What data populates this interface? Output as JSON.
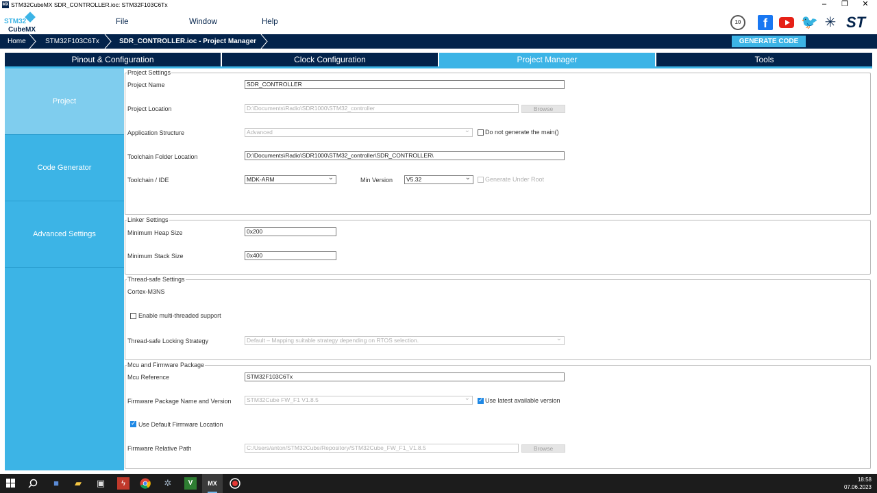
{
  "window": {
    "title": "STM32CubeMX SDR_CONTROLLER.ioc: STM32F103C6Tx",
    "app_icon": "MX",
    "minimize": "–",
    "restore": "❐",
    "close": "✕"
  },
  "logo": {
    "line1": "STM32",
    "line2": "CubeMX"
  },
  "menu": {
    "file": "File",
    "window": "Window",
    "help": "Help"
  },
  "social": {
    "anniversary": "10",
    "facebook": "f",
    "twitter": "🐦",
    "network": "✳",
    "st": "ST"
  },
  "breadcrumb": {
    "home": "Home",
    "mcu": "STM32F103C6Tx",
    "current": "SDR_CONTROLLER.ioc - Project Manager"
  },
  "generate_button": "GENERATE CODE",
  "tabs": {
    "pinout": "Pinout & Configuration",
    "clock": "Clock Configuration",
    "project_manager": "Project Manager",
    "tools": "Tools"
  },
  "sidebar": {
    "project": "Project",
    "code_generator": "Code Generator",
    "advanced": "Advanced Settings"
  },
  "project_settings": {
    "legend": "Project Settings",
    "name_label": "Project Name",
    "name_value": "SDR_CONTROLLER",
    "location_label": "Project Location",
    "location_value": "D:\\Documents\\Radio\\SDR1000\\STM32_controller",
    "browse": "Browse",
    "app_structure_label": "Application Structure",
    "app_structure_value": "Advanced",
    "no_main_label": "Do not generate the main()",
    "toolchain_folder_label": "Toolchain Folder Location",
    "toolchain_folder_value": "D:\\Documents\\Radio\\SDR1000\\STM32_controller\\SDR_CONTROLLER\\",
    "toolchain_label": "Toolchain / IDE",
    "toolchain_value": "MDK-ARM",
    "min_version_label": "Min Version",
    "min_version_value": "V5.32",
    "gen_under_root_label": "Generate Under Root"
  },
  "linker_settings": {
    "legend": "Linker Settings",
    "heap_label": "Minimum Heap Size",
    "heap_value": "0x200",
    "stack_label": "Minimum Stack Size",
    "stack_value": "0x400"
  },
  "thread_settings": {
    "legend": "Thread-safe Settings",
    "core": "Cortex-M3NS",
    "multithread_label": "Enable multi-threaded support",
    "strategy_label": "Thread-safe Locking Strategy",
    "strategy_value": "Default – Mapping suitable strategy depending on RTOS selection."
  },
  "firmware": {
    "legend": "Mcu and Firmware Package",
    "mcu_ref_label": "Mcu Reference",
    "mcu_ref_value": "STM32F103C6Tx",
    "package_label": "Firmware Package Name and Version",
    "package_value": "STM32Cube FW_F1 V1.8.5",
    "latest_label": "Use latest available version",
    "default_location_label": "Use Default Firmware Location",
    "relative_path_label": "Firmware Relative Path",
    "relative_path_value": "C:/Users/anton/STM32Cube/Repository/STM32Cube_FW_F1_V1.8.5",
    "browse": "Browse"
  },
  "taskbar": {
    "time": "18:58",
    "date": "07.06.2023",
    "icons": [
      "windows-start",
      "search",
      "save",
      "file-explorer",
      "store",
      "flash-tool",
      "chrome",
      "bug-tool",
      "vscode",
      "stm32cubemx",
      "recorder"
    ]
  }
}
